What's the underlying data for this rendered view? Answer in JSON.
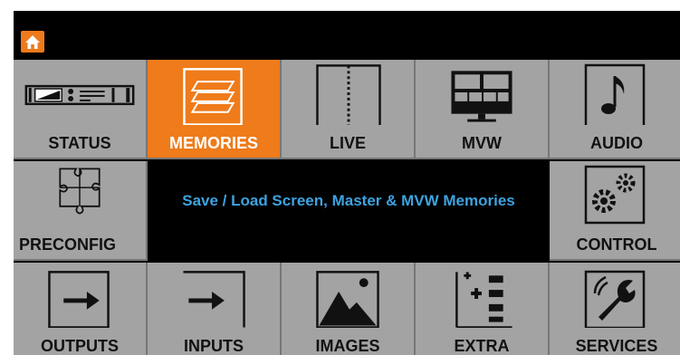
{
  "header": {
    "home_icon": "home-icon",
    "accent_color": "#ee7a1b"
  },
  "tiles": {
    "status": {
      "label": "STATUS",
      "icon": "device-front-panel-icon"
    },
    "memories": {
      "label": "MEMORIES",
      "icon": "layers-icon",
      "active": true
    },
    "live": {
      "label": "LIVE",
      "icon": "split-screen-icon"
    },
    "mvw": {
      "label": "MVW",
      "icon": "monitor-multiview-icon"
    },
    "audio": {
      "label": "AUDIO",
      "icon": "music-note-icon"
    },
    "preconfig": {
      "label": "PRECONFIG",
      "icon": "puzzle-icon"
    },
    "control": {
      "label": "CONTROL",
      "icon": "gears-icon"
    },
    "outputs": {
      "label": "OUTPUTS",
      "icon": "arrow-out-icon"
    },
    "inputs": {
      "label": "INPUTS",
      "icon": "arrow-in-icon"
    },
    "images": {
      "label": "IMAGES",
      "icon": "image-icon"
    },
    "extra": {
      "label": "EXTRA",
      "icon": "add-list-icon"
    },
    "services": {
      "label": "SERVICES",
      "icon": "wrench-icon"
    }
  },
  "info": {
    "text": "Save / Load Screen, Master & MVW Memories",
    "color": "#3da3e0"
  }
}
